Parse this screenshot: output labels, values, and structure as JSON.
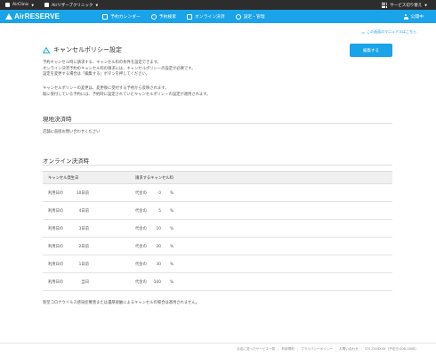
{
  "topbar": {
    "account": "AirClinic",
    "store": "Airリザーブクリニック",
    "switch_service": "サービス切り替え"
  },
  "nav": {
    "brand": "AirRESERVE",
    "items": [
      {
        "label": "予約カレンダー",
        "icon": "calendar-icon"
      },
      {
        "label": "予約検索",
        "icon": "search-icon"
      },
      {
        "label": "オンライン決済",
        "icon": "card-icon"
      },
      {
        "label": "設定・管理",
        "icon": "gear-icon"
      }
    ],
    "status": "公開中"
  },
  "help_link": "この画面のマニュアルはこちら",
  "page": {
    "title": "キャンセルポリシー設定",
    "edit_button": "編集する",
    "desc1": [
      "予約キャンセル時に請求する、キャンセル料の条件を設定できます。",
      "オンライン決済予約のキャンセル料の請求には、キャンセルポリシーの設定が必要です。",
      "設定を変更する場合は「編集する」ボタンを押してください。"
    ],
    "desc2": [
      "キャンセルポリシーの変更は、変更後に受付する予約から反映されます。",
      "既に受付している予約には、予約時に設定されていたキャンセルポリシーの設定が適用されます。"
    ]
  },
  "onsite": {
    "title": "現地決済時",
    "text": "店舗に直接お問い合わせください"
  },
  "online": {
    "title": "オンライン決済時",
    "headers": [
      "キャンセル発生日",
      "請求するキャンセル料"
    ],
    "rows": [
      {
        "day_label": "利用日の",
        "day_value": "10日前",
        "fee_label": "代金の",
        "fee_value": "0",
        "unit": "%"
      },
      {
        "day_label": "利用日の",
        "day_value": "4日前",
        "fee_label": "代金の",
        "fee_value": "5",
        "unit": "%"
      },
      {
        "day_label": "利用日の",
        "day_value": "3日前",
        "fee_label": "代金の",
        "fee_value": "10",
        "unit": "%"
      },
      {
        "day_label": "利用日の",
        "day_value": "2日前",
        "fee_label": "代金の",
        "fee_value": "20",
        "unit": "%"
      },
      {
        "day_label": "利用日の",
        "day_value": "1日前",
        "fee_label": "代金の",
        "fee_value": "30",
        "unit": "%"
      },
      {
        "day_label": "利用日の",
        "day_value": "当日",
        "fee_label": "代金の",
        "fee_value": "100",
        "unit": "%"
      }
    ],
    "note": "新型コロナウイルス感染症罹患または濃厚接触によるキャンセルの場合は適用されません。"
  },
  "footer": {
    "links": [
      "お店に送ったサービス一覧",
      "利用規約",
      "プライバシーポリシー",
      "お問い合わせ"
    ],
    "id_text": "C012344XXX（予定日:006-1806）"
  },
  "colors": {
    "brand_blue": "#1aa3e8",
    "topbar_dark": "#2d2d2d"
  }
}
